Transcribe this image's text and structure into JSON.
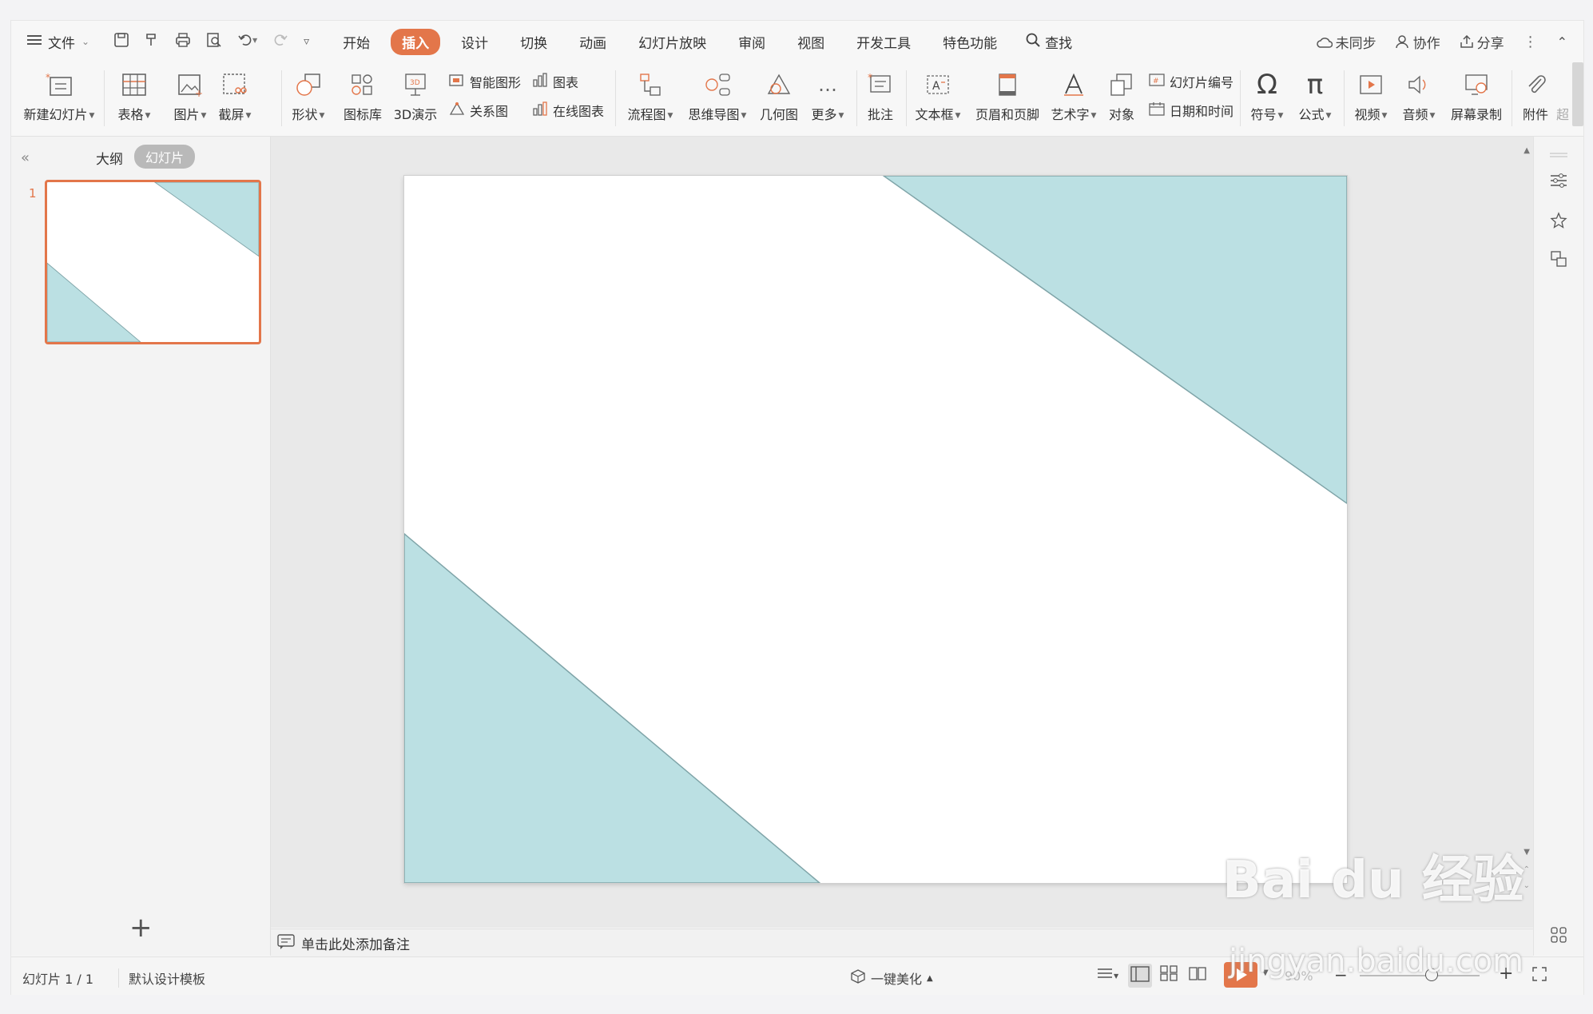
{
  "menubar": {
    "file_label": "文件",
    "tabs": [
      {
        "label": "开始"
      },
      {
        "label": "插入",
        "active": true
      },
      {
        "label": "设计"
      },
      {
        "label": "切换"
      },
      {
        "label": "动画"
      },
      {
        "label": "幻灯片放映"
      },
      {
        "label": "审阅"
      },
      {
        "label": "视图"
      },
      {
        "label": "开发工具"
      },
      {
        "label": "特色功能"
      }
    ],
    "search_label": "查找",
    "sync_label": "未同步",
    "collab_label": "协作",
    "share_label": "分享"
  },
  "ribbon": {
    "new_slide": "新建幻灯片",
    "table": "表格",
    "picture": "图片",
    "screenshot": "截屏",
    "shape": "形状",
    "icon_lib": "图标库",
    "demo3d": "3D演示",
    "smart_graphic": "智能图形",
    "chart": "图表",
    "relation": "关系图",
    "online_chart": "在线图表",
    "flowchart": "流程图",
    "mindmap": "思维导图",
    "geometry": "几何图",
    "more": "更多",
    "comment": "批注",
    "textbox": "文本框",
    "header_footer": "页眉和页脚",
    "wordart": "艺术字",
    "object": "对象",
    "slide_number": "幻灯片编号",
    "datetime": "日期和时间",
    "symbol": "符号",
    "formula": "公式",
    "video": "视频",
    "audio": "音频",
    "screen_record": "屏幕录制",
    "attachment": "附件",
    "super": "超"
  },
  "leftpanel": {
    "outline_tab": "大纲",
    "slides_tab": "幻灯片",
    "slide_number": "1"
  },
  "notes": {
    "placeholder": "单击此处添加备注"
  },
  "statusbar": {
    "slide_info": "幻灯片 1 / 1",
    "template": "默认设计模板",
    "beautify": "一键美化",
    "zoom": "90%"
  },
  "watermark": {
    "brand": "Bai du 经验",
    "url": "jingyan.baidu.com"
  },
  "colors": {
    "accent": "#e3764a",
    "shape_fill": "#bbe0e3",
    "shape_stroke": "#7fa4a8"
  }
}
